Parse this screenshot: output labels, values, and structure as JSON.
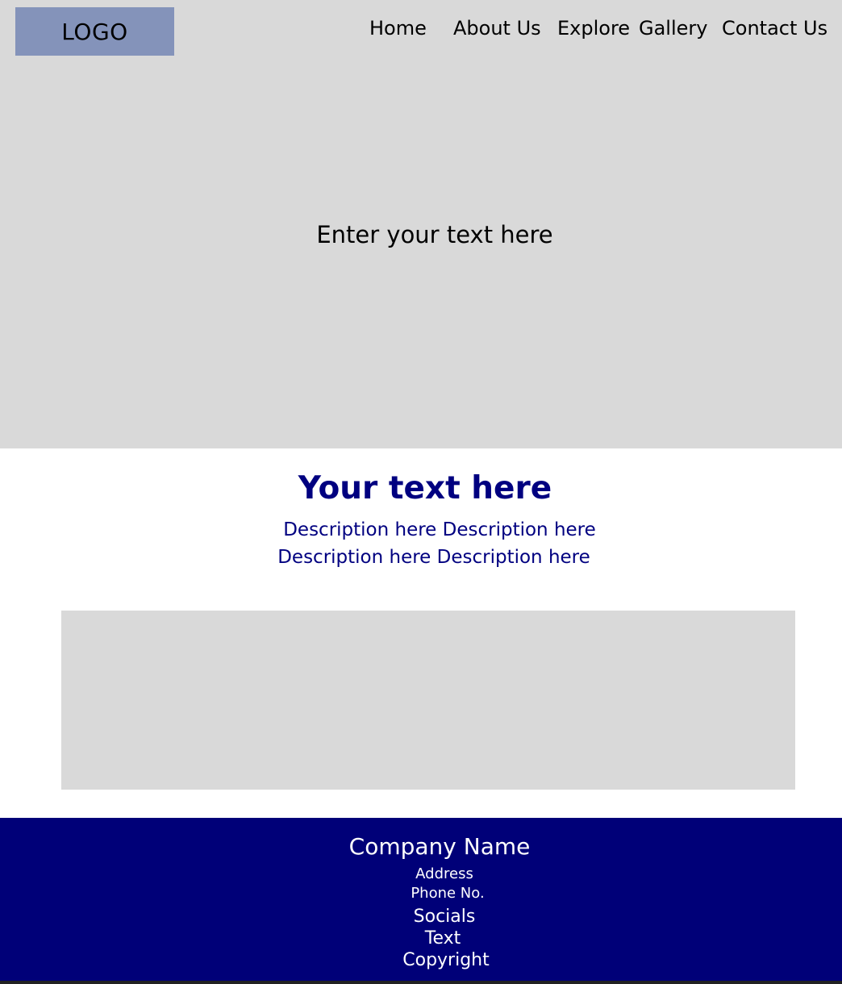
{
  "header": {
    "logo_label": "LOGO",
    "nav": [
      "Home",
      "About Us",
      "Explore",
      "Gallery",
      "Contact Us"
    ]
  },
  "hero": {
    "text": "Enter your text here"
  },
  "content": {
    "headline": "Your text here",
    "description_lines": [
      "Description here Description here",
      "Description here Description here"
    ]
  },
  "footer": {
    "company_name": "Company Name",
    "address": "Address",
    "phone": "Phone No.",
    "socials": "Socials",
    "text": "Text",
    "copyright": "Copyright"
  },
  "colors": {
    "hero_bg": "#d9d9d9",
    "logo_bg": "#8493ba",
    "accent_navy": "#000080",
    "footer_bg": "#000078"
  }
}
